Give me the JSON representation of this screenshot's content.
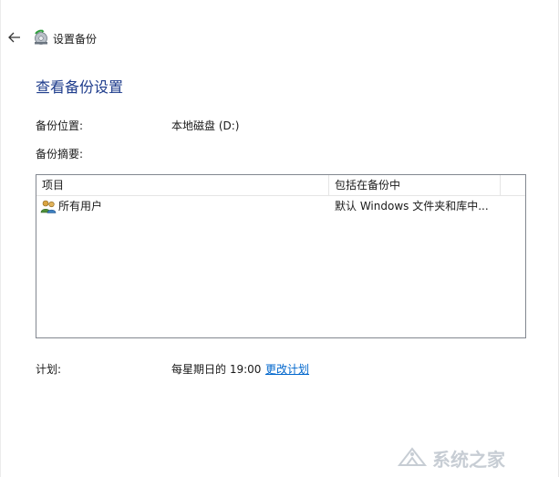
{
  "window": {
    "title": "设置备份",
    "back_icon": "arrow-left-icon",
    "app_icon": "backup-app-icon"
  },
  "page": {
    "heading": "查看备份设置"
  },
  "settings": {
    "location_label": "备份位置:",
    "location_value": "本地磁盘 (D:)",
    "summary_label": "备份摘要:",
    "schedule_label": "计划:",
    "schedule_value": "每星期日的 19:00",
    "change_schedule_link": "更改计划"
  },
  "summary_table": {
    "columns": [
      "项目",
      "包括在备份中"
    ],
    "rows": [
      {
        "item": "所有用户",
        "icon": "users-icon",
        "included": "默认 Windows 文件夹和库中..."
      }
    ]
  },
  "watermark": {
    "icon": "watermark-logo-icon",
    "text": "系统之家"
  },
  "colors": {
    "heading": "#1e3c8c",
    "link": "#0066cc",
    "table_border": "#828790"
  }
}
